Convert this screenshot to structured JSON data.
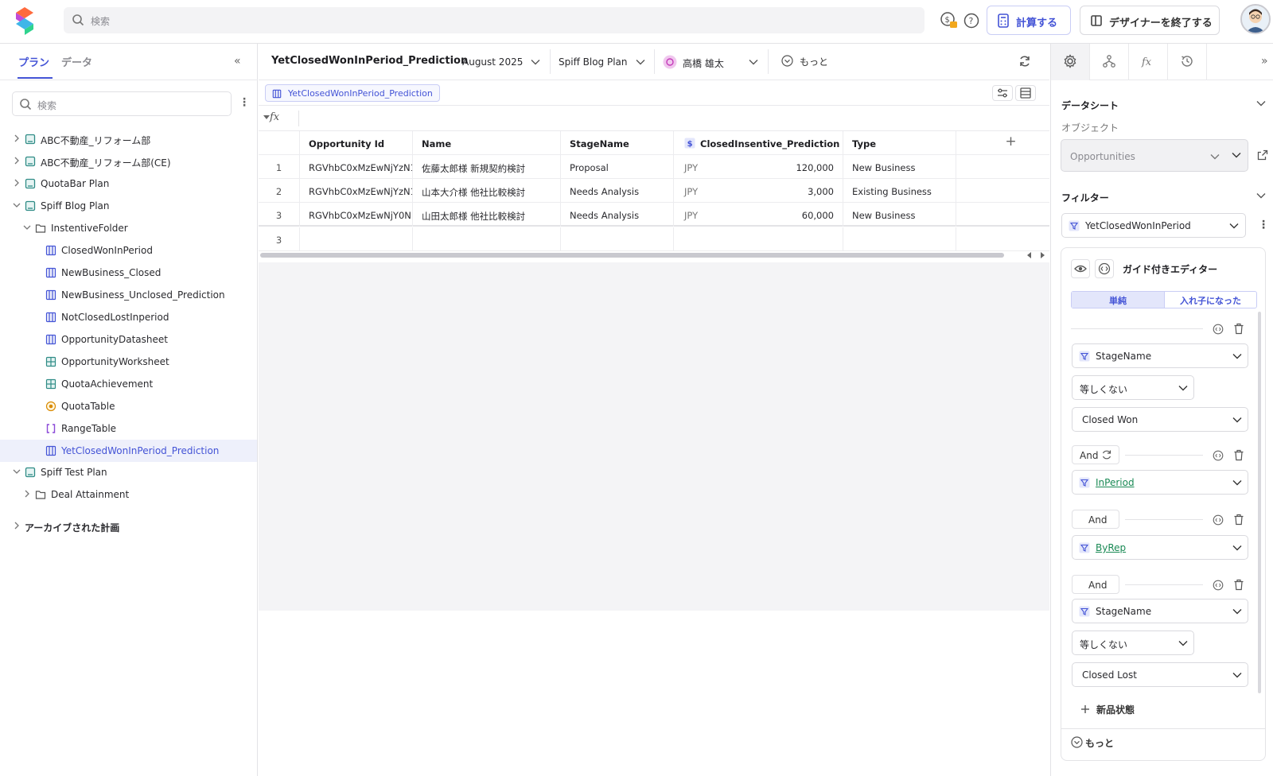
{
  "topbar": {
    "search_placeholder": "検索",
    "calc_label": "計算する",
    "designer_exit_label": "デザイナーを終了する",
    "icons": [
      "logo-icon",
      "commission-lock-icon",
      "help-icon",
      "calculator-icon",
      "designer-icon",
      "avatar"
    ]
  },
  "sidebar": {
    "tab_plan": "プラン",
    "tab_data": "データ",
    "collapse": "«",
    "search_placeholder": "検索",
    "kebab": "⋮",
    "items": [
      {
        "label": "ABC不動産_リフォーム部"
      },
      {
        "label": "ABC不動産_リフォーム部(CE)"
      },
      {
        "label": "QuotaBar Plan"
      },
      {
        "label": "Spiff Blog Plan"
      },
      {
        "label": "InstentiveFolder"
      },
      {
        "label": "ClosedWonInPeriod"
      },
      {
        "label": "NewBusiness_Closed"
      },
      {
        "label": "NewBusiness_Unclosed_Prediction"
      },
      {
        "label": "NotClosedLostInperiod"
      },
      {
        "label": "OpportunityDatasheet"
      },
      {
        "label": "OpportunityWorksheet"
      },
      {
        "label": "QuotaAchievement"
      },
      {
        "label": "QuotaTable"
      },
      {
        "label": "RangeTable"
      },
      {
        "label": "YetClosedWonInPeriod_Prediction"
      },
      {
        "label": "Spiff Test Plan"
      },
      {
        "label": "Deal Attainment"
      },
      {
        "label": "アーカイブされた計画"
      }
    ]
  },
  "center": {
    "title": "YetClosedWonInPeriod_Prediction",
    "period": "August 2025",
    "plan": "Spiff Blog Plan",
    "user": "高橋 雄太",
    "more": "もっと",
    "sheet_chip": "YetClosedWonInPeriod_Prediction",
    "fx": "fx",
    "columns": [
      "",
      "Opportunity Id",
      "Name",
      "StageName",
      "ClosedInsentive_Prediction",
      "Type"
    ],
    "add_col": "+",
    "rows": [
      {
        "n": "1",
        "id": "RGVhbC0xMzEwNjYzN1",
        "name": "佐藤太郎様 新規契約検討",
        "stage": "Proposal",
        "cur": "JPY",
        "amount": "120,000",
        "type": "New Business"
      },
      {
        "n": "2",
        "id": "RGVhbC0xMzEwNjYzN1",
        "name": "山本大介様 他社比較検討",
        "stage": "Needs Analysis",
        "cur": "JPY",
        "amount": "3,000",
        "type": "Existing Business"
      },
      {
        "n": "3",
        "id": "RGVhbC0xMzEwNjY0N",
        "name": "山田太郎様 他社比較検討",
        "stage": "Needs Analysis",
        "cur": "JPY",
        "amount": "60,000",
        "type": "New Business"
      }
    ],
    "row_count": "3"
  },
  "right": {
    "expand": "»",
    "datasheet_title": "データシート",
    "object_label": "オブジェクト",
    "object_value": "Opportunities",
    "filter_title": "フィルター",
    "filter_value": "YetClosedWonInPeriod",
    "guided_title": "ガイド付きエディター",
    "mode_simple": "単純",
    "mode_nested": "入れ子になった",
    "cond1_field": "StageName",
    "cond1_op": "等しくない",
    "cond1_val": "Closed Won",
    "and1": "And",
    "cond2_field": "InPeriod",
    "and2": "And",
    "cond3_field": "ByRep",
    "and3": "And",
    "cond4_field": "StageName",
    "cond4_op": "等しくない",
    "cond4_val": "Closed Lost",
    "new_item": "新品状態",
    "more": "もっと"
  },
  "colors": {
    "accent": "#4353d6",
    "link_green": "#1a8a55",
    "selected_bg": "#eef0fb"
  }
}
